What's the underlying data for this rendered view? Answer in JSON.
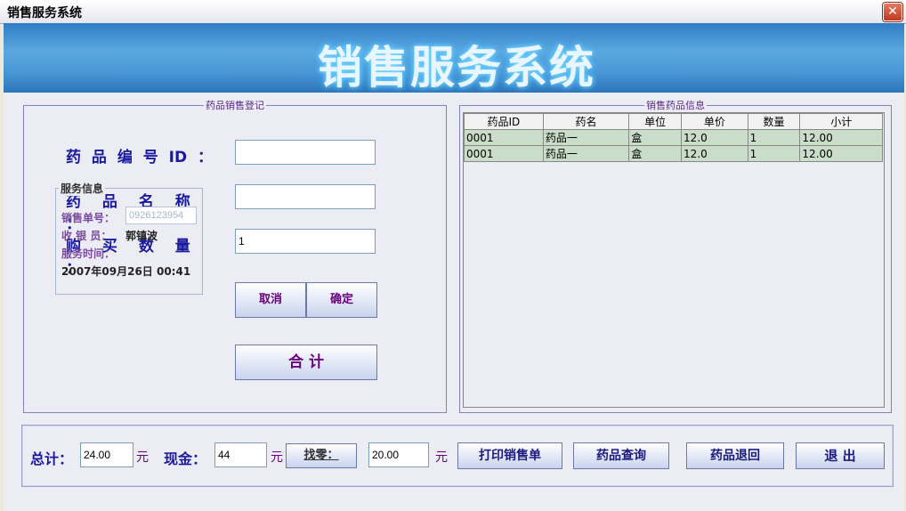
{
  "window": {
    "title": "销售服务系统",
    "close_icon": "close-icon"
  },
  "banner": {
    "title": "销售服务系统"
  },
  "register": {
    "legend": "药品销售登记",
    "id_label": "药 品 编 号 ID ：",
    "name_label": "药 品 名 称 ：",
    "qty_label": "购 买 数 量 ：",
    "id_value": "",
    "name_value": "",
    "qty_value": "1",
    "cancel_button": "取消",
    "confirm_button": "确定",
    "total_button": "合 计"
  },
  "service": {
    "title": "服务信息",
    "order_label": "销售单号：",
    "order_value": "0926123954",
    "cashier_label": "收 银 员：",
    "cashier_value": "郭镇波",
    "time_label": "服务时间：",
    "time_value": "2007年09月26日 00:41"
  },
  "sales": {
    "legend": "销售药品信息",
    "columns": [
      "药品ID",
      "药名",
      "单位",
      "单价",
      "数量",
      "小计"
    ],
    "rows": [
      [
        "0001",
        "药品一",
        "盒",
        "12.0",
        "1",
        "12.00"
      ],
      [
        "0001",
        "药品一",
        "盒",
        "12.0",
        "1",
        "12.00"
      ]
    ]
  },
  "footer": {
    "total_label": "总计：",
    "total_value": "24.00",
    "cash_label": "现金：",
    "cash_value": "44",
    "change_button": "找零：",
    "change_value": "20.00",
    "yuan": "元",
    "print_button": "打印销售单",
    "query_button": "药品查询",
    "return_button": "药品退回",
    "exit_button": "退 出"
  }
}
